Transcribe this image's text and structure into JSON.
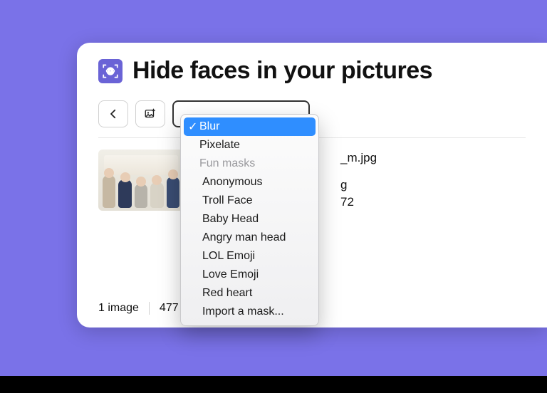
{
  "header": {
    "title": "Hide faces in your pictures"
  },
  "dropdown": {
    "selected": "Blur",
    "items": {
      "blur": "Blur",
      "pixelate": "Pixelate",
      "funmasks_header": "Fun masks",
      "anonymous": "Anonymous",
      "trollface": "Troll Face",
      "babyhead": "Baby Head",
      "angryman": "Angry man head",
      "lolemoji": "LOL Emoji",
      "loveemoji": "Love Emoji",
      "redheart": "Red heart",
      "import": "Import a mask..."
    }
  },
  "file": {
    "name_suffix": "_m.jpg",
    "info_line1": "g",
    "info_line2": "72"
  },
  "footer": {
    "count": "1 image",
    "size_prefix": "477"
  }
}
